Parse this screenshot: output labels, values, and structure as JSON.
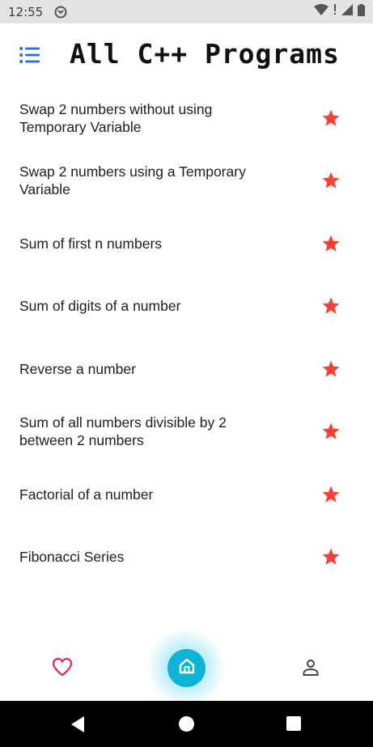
{
  "status_bar": {
    "time": "12:55",
    "icons": [
      "sync-icon",
      "wifi-icon",
      "notification-icon",
      "cellular-icon",
      "battery-icon"
    ]
  },
  "header": {
    "title": "All C++ Programs",
    "menu_icon": "list-menu-icon"
  },
  "programs": [
    {
      "label": "Swap 2 numbers without using Temporary Variable",
      "starred": true
    },
    {
      "label": "Swap 2 numbers using a Temporary Variable",
      "starred": true
    },
    {
      "label": "Sum of first n numbers",
      "starred": true
    },
    {
      "label": "Sum of digits of a number",
      "starred": true
    },
    {
      "label": "Reverse a number",
      "starred": true
    },
    {
      "label": "Sum of all numbers divisible by 2 between 2 numbers",
      "starred": true
    },
    {
      "label": "Factorial of a number",
      "starred": true
    },
    {
      "label": "Fibonacci Series",
      "starred": true
    }
  ],
  "bottom_nav": {
    "items": [
      "heart-icon",
      "home-icon",
      "person-icon"
    ],
    "active": "home-icon"
  },
  "colors": {
    "accent": "#0fb3d5",
    "star": "#f44336",
    "heart": "#e0245e",
    "menu_icon": "#1e6fd9",
    "status_bar_bg": "#e3e3e3"
  }
}
